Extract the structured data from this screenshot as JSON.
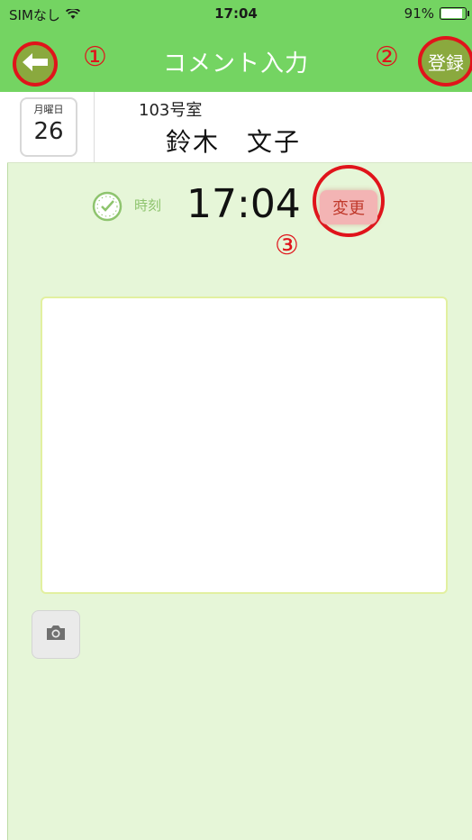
{
  "status_bar": {
    "carrier": "SIMなし",
    "time": "17:04",
    "battery": "91%",
    "battery_level": 0.91
  },
  "nav": {
    "title": "コメント入力",
    "register_label": "登録"
  },
  "markers": {
    "one": "①",
    "two": "②",
    "three": "③"
  },
  "header": {
    "day_of_week": "月曜日",
    "day": "26",
    "room": "103号室",
    "name": "鈴木　文子"
  },
  "time_row": {
    "label": "時刻",
    "value": "17:04",
    "change_label": "変更"
  },
  "comment": {
    "value": ""
  },
  "colors": {
    "nav_green": "#74d462",
    "content_bg": "#e6f6d8",
    "annotation_red": "#e0141b"
  }
}
